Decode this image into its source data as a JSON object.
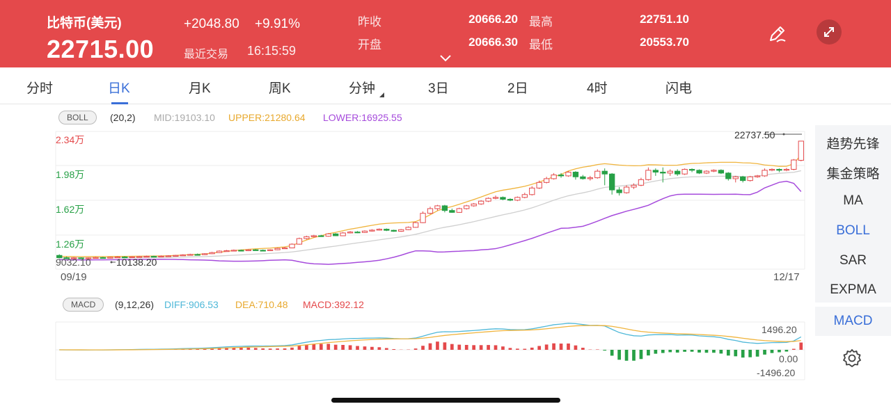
{
  "header": {
    "name": "比特币(美元)",
    "price": "22715.00",
    "change": "+2048.80",
    "change_pct": "+9.91%",
    "trade_label": "最近交易",
    "trade_time": "16:15:59",
    "prev_close_label": "昨收",
    "prev_close": "20666.20",
    "open_label": "开盘",
    "open": "20666.30",
    "high_label": "最高",
    "high": "22751.10",
    "low_label": "最低",
    "low": "20553.70",
    "accent_color": "#e4494b"
  },
  "tabs": [
    {
      "label": "分时"
    },
    {
      "label": "日K"
    },
    {
      "label": "月K"
    },
    {
      "label": "周K"
    },
    {
      "label": "分钟"
    },
    {
      "label": "3日"
    },
    {
      "label": "2日"
    },
    {
      "label": "4时"
    },
    {
      "label": "闪电"
    }
  ],
  "active_tab": "日K",
  "boll": {
    "tag": "BOLL",
    "params": "(20,2)",
    "mid": "MID:19103.10",
    "upper": "UPPER:21280.64",
    "lower": "LOWER:16925.55"
  },
  "macd": {
    "tag": "MACD",
    "params": "(9,12,26)",
    "diff": "DIFF:906.53",
    "dea": "DEA:710.48",
    "macd": "MACD:392.12"
  },
  "main_chart": {
    "y_labels": [
      "2.34万",
      "1.98万",
      "1.62万",
      "1.26万"
    ],
    "max_marker": "22737.50",
    "min_marker": "10138.20",
    "low_left_label": "9032.10",
    "x_start": "09/19",
    "x_end": "12/17"
  },
  "macd_chart": {
    "y_labels": [
      "1496.20",
      "0.00",
      "-1496.20"
    ]
  },
  "sidebar": [
    {
      "label": "趋势先锋"
    },
    {
      "label": "集金策略"
    },
    {
      "label": "MA"
    },
    {
      "label": "BOLL"
    },
    {
      "label": "SAR"
    },
    {
      "label": "EXPMA"
    },
    {
      "label": "MACD"
    }
  ],
  "colors": {
    "up": "#e4494b",
    "down": "#27a046",
    "mid_line": "#cfcfcf",
    "upper_line": "#f0b43c",
    "lower_line": "#a64bdc",
    "diff_line": "#4fb8d8",
    "dea_line": "#f0b43c",
    "active": "#3a6fd8"
  },
  "chart_data": {
    "type": "candlestick",
    "x_start": "09/19",
    "x_end": "12/17",
    "y_range": [
      9032.1,
      23400
    ],
    "candles": [
      [
        10500,
        10250,
        10620,
        10180
      ],
      [
        10250,
        10200,
        10380,
        10100
      ],
      [
        10200,
        10240,
        10310,
        10120
      ],
      [
        10240,
        10160,
        10300,
        10110
      ],
      [
        10160,
        10230,
        10280,
        10100
      ],
      [
        10230,
        10270,
        10330,
        10180
      ],
      [
        10270,
        10200,
        10340,
        10150
      ],
      [
        10200,
        10300,
        10360,
        10170
      ],
      [
        10300,
        10330,
        10400,
        10250
      ],
      [
        10330,
        10280,
        10420,
        10230
      ],
      [
        10280,
        10350,
        10410,
        10240
      ],
      [
        10350,
        10370,
        10450,
        10300
      ],
      [
        10370,
        10400,
        10480,
        10320
      ],
      [
        10400,
        10340,
        10470,
        10300
      ],
      [
        10340,
        10420,
        10500,
        10300
      ],
      [
        10420,
        10450,
        10520,
        10380
      ],
      [
        10450,
        10500,
        10560,
        10420
      ],
      [
        10500,
        10550,
        10620,
        10460
      ],
      [
        10550,
        10600,
        10680,
        10520
      ],
      [
        10600,
        10580,
        10700,
        10530
      ],
      [
        10580,
        10680,
        10740,
        10540
      ],
      [
        10680,
        10800,
        10880,
        10640
      ],
      [
        10800,
        10960,
        11040,
        10760
      ],
      [
        10960,
        11000,
        11080,
        10900
      ],
      [
        11000,
        11050,
        11130,
        10940
      ],
      [
        11050,
        11000,
        11120,
        10940
      ],
      [
        11000,
        11100,
        11180,
        10960
      ],
      [
        11100,
        11050,
        11180,
        11000
      ],
      [
        11050,
        11020,
        11130,
        10980
      ],
      [
        11020,
        11100,
        11160,
        10990
      ],
      [
        11100,
        11250,
        11320,
        11060
      ],
      [
        11250,
        11300,
        11400,
        11200
      ],
      [
        11300,
        11700,
        11780,
        11260
      ],
      [
        11700,
        12300,
        12400,
        11650
      ],
      [
        12300,
        12500,
        12600,
        12200
      ],
      [
        12500,
        12600,
        12700,
        12420
      ],
      [
        12600,
        12550,
        12700,
        12480
      ],
      [
        12550,
        12800,
        12880,
        12500
      ],
      [
        12800,
        12600,
        12880,
        12560
      ],
      [
        12600,
        12900,
        13000,
        12560
      ],
      [
        12900,
        13000,
        13100,
        12850
      ],
      [
        13000,
        12950,
        13100,
        12880
      ],
      [
        12950,
        13100,
        13180,
        12900
      ],
      [
        13100,
        13200,
        13300,
        13050
      ],
      [
        13200,
        13300,
        13380,
        13150
      ],
      [
        13300,
        13180,
        13380,
        13100
      ],
      [
        13180,
        13080,
        13250,
        13020
      ],
      [
        13080,
        13250,
        13320,
        13020
      ],
      [
        13250,
        13500,
        13600,
        13200
      ],
      [
        13500,
        14000,
        14100,
        13450
      ],
      [
        14000,
        15000,
        15200,
        13950
      ],
      [
        15000,
        15500,
        15700,
        14900
      ],
      [
        15500,
        15800,
        15900,
        15300
      ],
      [
        15800,
        15300,
        15900,
        15100
      ],
      [
        15300,
        15100,
        15500,
        15050
      ],
      [
        15100,
        15500,
        15600,
        15050
      ],
      [
        15500,
        15800,
        15900,
        15400
      ],
      [
        15800,
        16000,
        16100,
        15700
      ],
      [
        16000,
        16300,
        16400,
        15900
      ],
      [
        16300,
        16600,
        16700,
        16200
      ],
      [
        16600,
        16700,
        16900,
        16500
      ],
      [
        16700,
        16500,
        16800,
        16400
      ],
      [
        16500,
        16400,
        16600,
        16300
      ],
      [
        16400,
        16700,
        16800,
        16300
      ],
      [
        16700,
        17000,
        17200,
        16600
      ],
      [
        17000,
        17700,
        17900,
        16900
      ],
      [
        17700,
        18300,
        18500,
        17600
      ],
      [
        18300,
        18700,
        18900,
        18200
      ],
      [
        18700,
        19100,
        19300,
        18600
      ],
      [
        19100,
        19000,
        19300,
        18800
      ],
      [
        19000,
        19400,
        19500,
        18900
      ],
      [
        19400,
        18900,
        19500,
        18600
      ],
      [
        18900,
        18700,
        19100,
        18600
      ],
      [
        18700,
        18800,
        19000,
        18500
      ],
      [
        18800,
        19500,
        19700,
        18700
      ],
      [
        19500,
        19200,
        19800,
        18000
      ],
      [
        19200,
        17500,
        19300,
        17000
      ],
      [
        17500,
        17200,
        17800,
        16900
      ],
      [
        17200,
        17800,
        18000,
        17100
      ],
      [
        17800,
        18000,
        18200,
        17600
      ],
      [
        18000,
        18600,
        18800,
        17900
      ],
      [
        18600,
        19600,
        19900,
        18500
      ],
      [
        19600,
        19400,
        19800,
        19000
      ],
      [
        19400,
        19300,
        19900,
        18300
      ],
      [
        19300,
        19500,
        19700,
        19000
      ],
      [
        19500,
        19200,
        19700,
        19000
      ],
      [
        19200,
        19700,
        19800,
        19100
      ],
      [
        19700,
        19600,
        19800,
        19400
      ],
      [
        19600,
        19300,
        19700,
        19200
      ],
      [
        19300,
        19500,
        19600,
        19200
      ],
      [
        19500,
        19600,
        19700,
        19400
      ],
      [
        19600,
        19300,
        19700,
        19200
      ],
      [
        19300,
        18700,
        19400,
        18500
      ],
      [
        18700,
        18900,
        19000,
        18300
      ],
      [
        18900,
        18500,
        19000,
        18300
      ],
      [
        18500,
        18900,
        19000,
        18400
      ],
      [
        18900,
        19000,
        19100,
        18800
      ],
      [
        19000,
        19600,
        19800,
        18900
      ],
      [
        19600,
        19700,
        19800,
        19500
      ],
      [
        19700,
        19600,
        19800,
        19400
      ],
      [
        19600,
        19700,
        19850,
        19500
      ],
      [
        19700,
        20700,
        20800,
        19600
      ],
      [
        20666.3,
        22715.0,
        22751.1,
        20553.7
      ]
    ]
  }
}
